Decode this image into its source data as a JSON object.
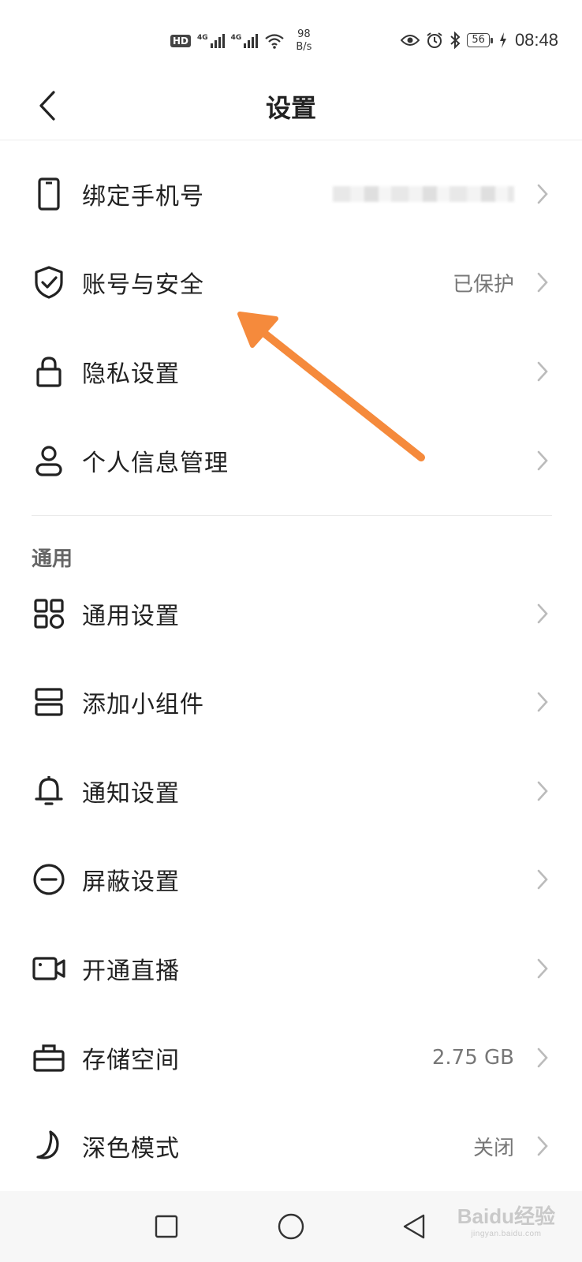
{
  "status_bar": {
    "hd": "HD",
    "sim1_tag": "4G",
    "sim2_tag": "4G",
    "net_speed_value": "98",
    "net_speed_unit": "B/s",
    "battery": "56",
    "time": "08:48",
    "icons": [
      "hd-icon",
      "signal-icon",
      "wifi-icon",
      "eye-icon",
      "alarm-icon",
      "bluetooth-icon",
      "battery-icon",
      "charging-icon"
    ]
  },
  "header": {
    "title": "设置",
    "back_icon": "chevron-left-icon"
  },
  "account_items": [
    {
      "label": "绑定手机号",
      "value": "",
      "icon": "phone-icon",
      "value_blurred": true
    },
    {
      "label": "账号与安全",
      "value": "已保护",
      "icon": "shield-check-icon"
    },
    {
      "label": "隐私设置",
      "value": "",
      "icon": "lock-icon"
    },
    {
      "label": "个人信息管理",
      "value": "",
      "icon": "person-icon"
    }
  ],
  "general_section": {
    "title": "通用",
    "items": [
      {
        "label": "通用设置",
        "value": "",
        "icon": "grid-icon"
      },
      {
        "label": "添加小组件",
        "value": "",
        "icon": "widget-icon"
      },
      {
        "label": "通知设置",
        "value": "",
        "icon": "bell-icon"
      },
      {
        "label": "屏蔽设置",
        "value": "",
        "icon": "block-icon"
      },
      {
        "label": "开通直播",
        "value": "",
        "icon": "video-camera-icon"
      },
      {
        "label": "存储空间",
        "value": "2.75 GB",
        "icon": "storage-box-icon"
      },
      {
        "label": "深色模式",
        "value": "关闭",
        "icon": "moon-icon"
      }
    ]
  },
  "annotation": {
    "arrow_color": "#F58A3C"
  },
  "nav_bar": {
    "icons": [
      "recent-apps-icon",
      "home-icon",
      "back-icon"
    ]
  },
  "watermark": {
    "text": "Baidu经验",
    "sub": "jingyan.baidu.com"
  },
  "colors": {
    "text": "#222222",
    "secondary": "#777777",
    "divider": "#EAEAEA",
    "background": "#FFFFFF"
  }
}
